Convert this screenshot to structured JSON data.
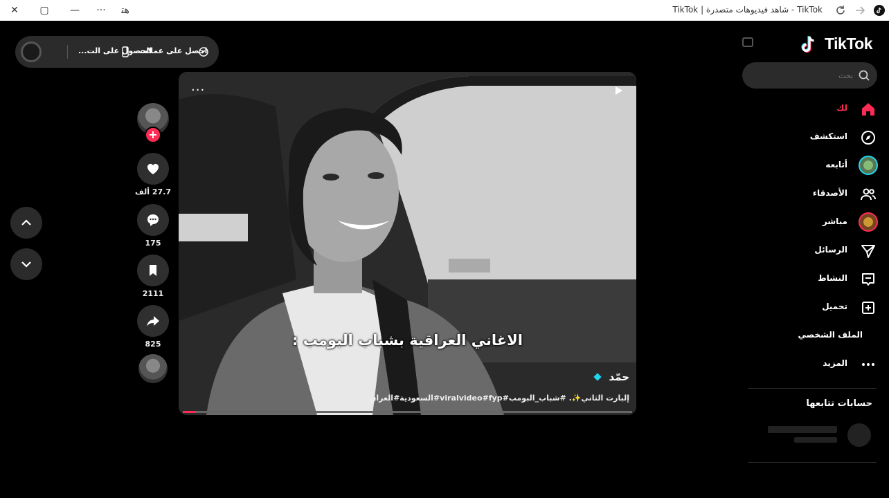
{
  "window": {
    "title": "TikTok | شاهد فيديوهات متصدرة - TikTok",
    "controls": {
      "close": "✕",
      "restore": "▢",
      "minimize": "—",
      "more": "···",
      "translate": "ﻫﺘ"
    }
  },
  "top_pill": {
    "get_effects": "احصل على عملات",
    "get_app": "الحصول على الت..."
  },
  "video": {
    "caption": "الاغاني العراقية بشباب البومب :",
    "author": "حمّد",
    "description": "إلبارت الثاني✨. #شباب_البومب#viralvideo#fyp#السعودية#العراق",
    "progress": 0.03
  },
  "actions": {
    "likes": "27.7 ألف",
    "comments": "175",
    "saves": "2111",
    "shares": "825"
  },
  "sidebar": {
    "brand": "TikTok",
    "search": {
      "placeholder": "بحث"
    },
    "items": [
      {
        "label": "لك",
        "icon": "home-icon",
        "active": true
      },
      {
        "label": "استكشف",
        "icon": "compass-icon"
      },
      {
        "label": "أتابعه",
        "icon": "avatar-icon"
      },
      {
        "label": "الأصدقاء",
        "icon": "friends-icon"
      },
      {
        "label": "مباشر",
        "icon": "live-avatar-icon"
      },
      {
        "label": "الرسائل",
        "icon": "send-icon"
      },
      {
        "label": "النشاط",
        "icon": "inbox-icon"
      },
      {
        "label": "تحميل",
        "icon": "upload-icon"
      },
      {
        "label": "الملف الشخصي",
        "icon": "profile-avatar"
      },
      {
        "label": "المزيد",
        "icon": "more-icon"
      }
    ],
    "following_title": "حسابات تتابعها"
  },
  "colors": {
    "accent": "#fe2c55",
    "cyan": "#20d5ec",
    "panel": "#2b2b2b"
  }
}
